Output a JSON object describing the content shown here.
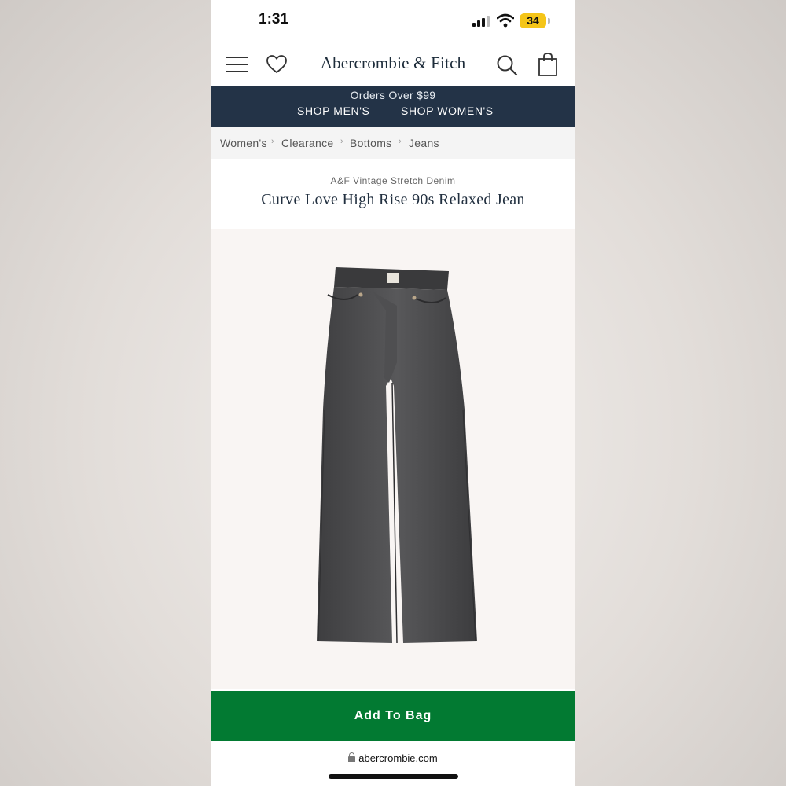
{
  "status_bar": {
    "time": "1:31",
    "battery": "34"
  },
  "nav": {
    "brand": "Abercrombie & Fitch"
  },
  "promo": {
    "line": "Orders Over $99",
    "shop_men": "SHOP MEN'S",
    "shop_women": "SHOP WOMEN'S"
  },
  "breadcrumb": [
    "Women's",
    "Clearance",
    "Bottoms",
    "Jeans"
  ],
  "product": {
    "collection": "A&F Vintage Stretch Denim",
    "title": "Curve Love High Rise 90s Relaxed Jean"
  },
  "actions": {
    "add_to_bag": "Add To Bag"
  },
  "browser": {
    "url": "abercrombie.com"
  },
  "colors": {
    "promo_bg": "#233347",
    "add_to_bag_bg": "#027a32",
    "denim": "#4a4a4c"
  },
  "icons": [
    "signal-icon",
    "wifi-icon",
    "menu-icon",
    "heart-icon",
    "search-icon",
    "bag-icon",
    "lock-icon"
  ]
}
